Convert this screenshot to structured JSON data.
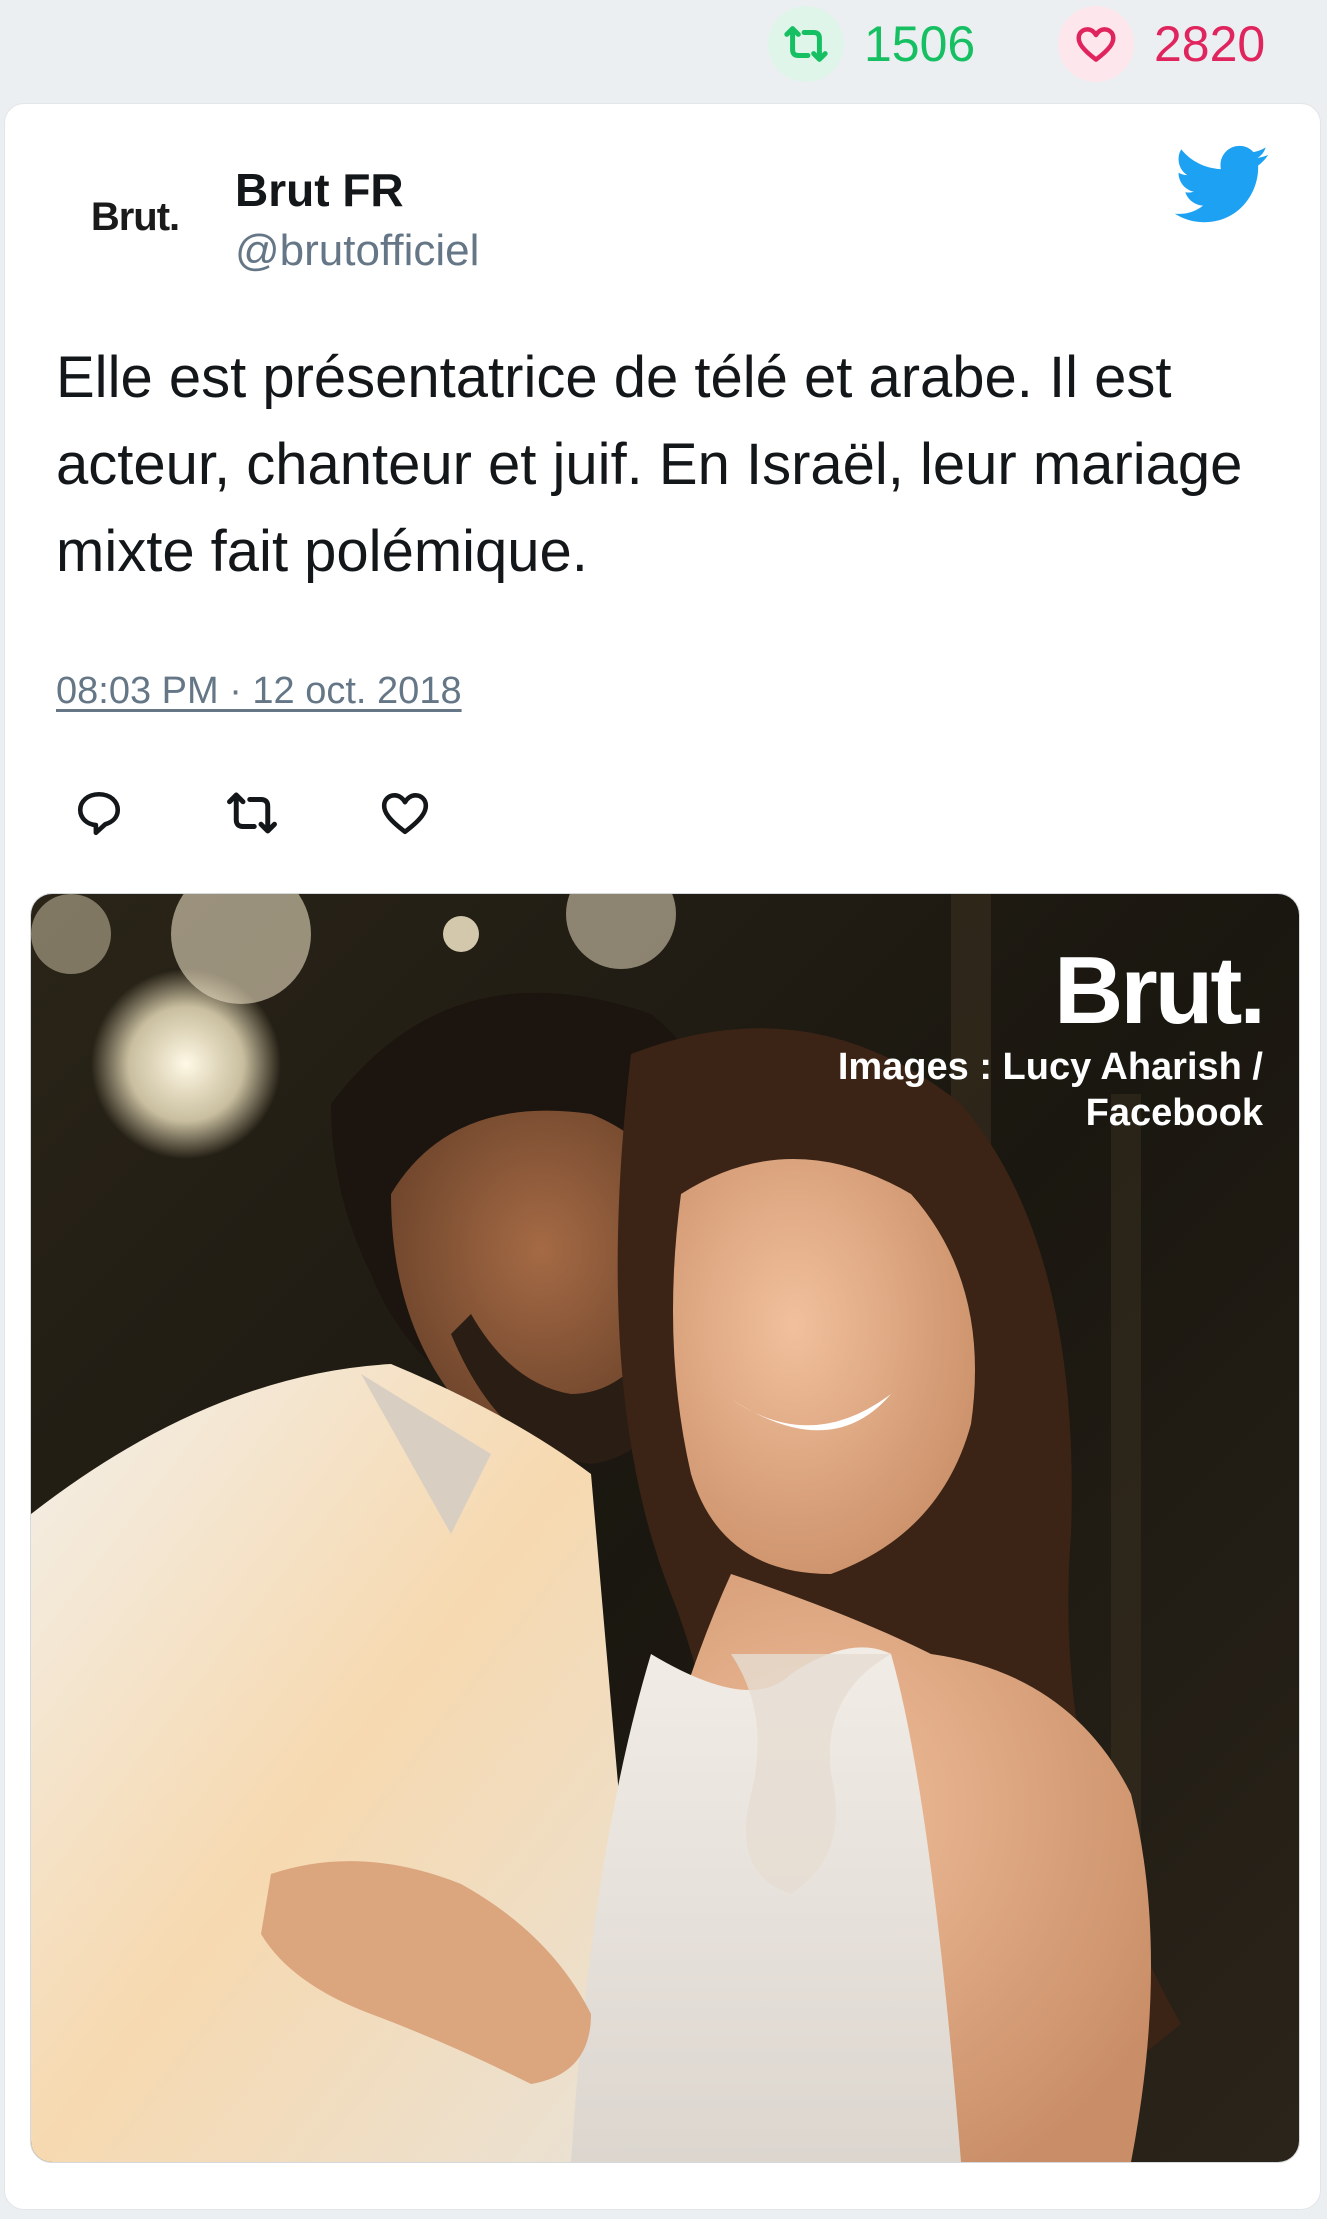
{
  "stats": {
    "retweets": "1506",
    "likes": "2820",
    "retweet_color": "#17bf63",
    "like_color": "#e0245e"
  },
  "tweet": {
    "avatar_logo": "Brut.",
    "author_name": "Brut FR",
    "author_handle": "@brutofficiel",
    "text": "Elle est présentatrice de télé et arabe. Il est acteur, chanteur et juif. En Israël, leur mariage mixte fait polémique.",
    "timestamp": "08:03 PM · 12 oct. 2018",
    "brand_icon": "twitter-bird-icon",
    "brand_color": "#1da1f2",
    "actions": [
      "reply-icon",
      "retweet-icon",
      "like-icon"
    ]
  },
  "media": {
    "watermark": "Brut.",
    "credit_line1": "Images : Lucy Aharish /",
    "credit_line2": "Facebook"
  }
}
